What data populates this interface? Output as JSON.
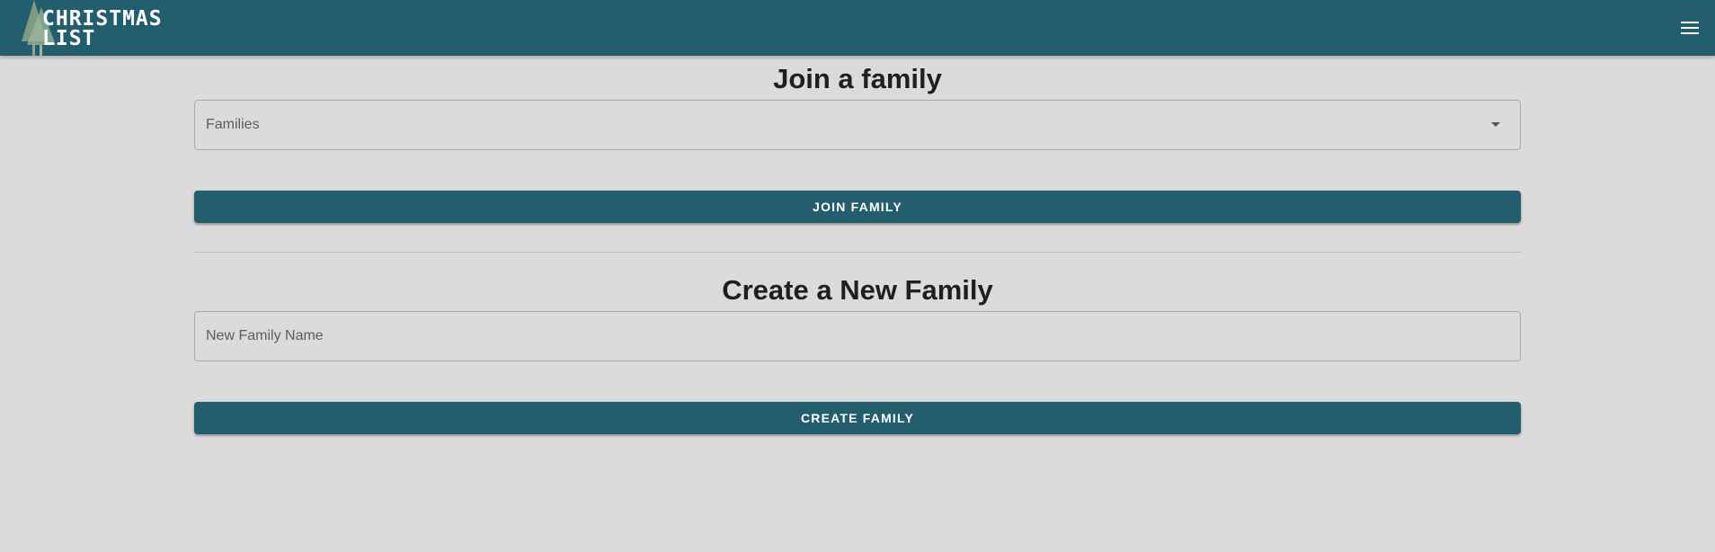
{
  "app": {
    "title_line1": "CHRISTMAS",
    "title_line2": "LIST",
    "logo_icon": "tree-icon",
    "menu_icon": "hamburger-menu-icon"
  },
  "join": {
    "title": "Join a family",
    "select_label": "Families",
    "button_label": "JOIN FAMILY"
  },
  "create": {
    "title": "Create a New Family",
    "input_placeholder": "New Family Name",
    "input_value": "",
    "button_label": "CREATE FAMILY"
  },
  "colors": {
    "primary": "#235e6f",
    "background": "#dcdbdb"
  }
}
